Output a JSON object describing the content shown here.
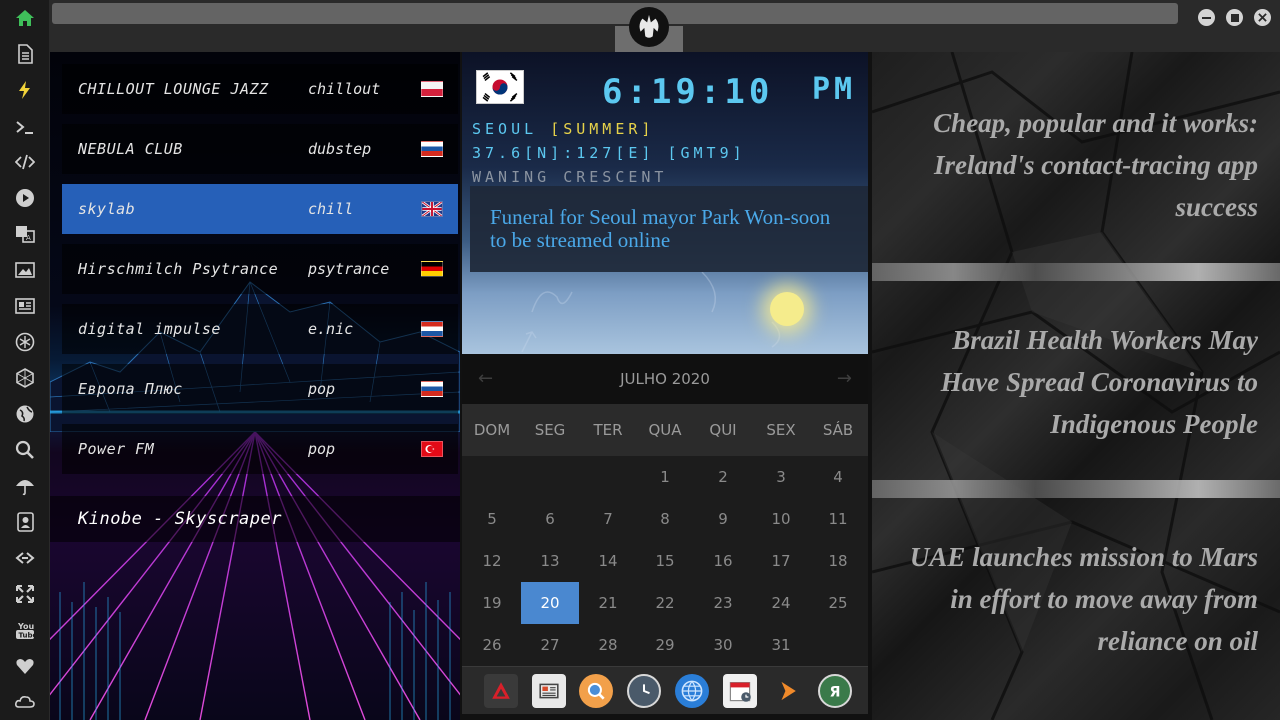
{
  "sidebar": {
    "items": [
      {
        "icon": "home-icon",
        "color": "#3fbf5a"
      },
      {
        "icon": "document-icon"
      },
      {
        "icon": "bolt-icon",
        "color": "#f2d43a"
      },
      {
        "icon": "terminal-icon"
      },
      {
        "icon": "code-icon"
      },
      {
        "icon": "play-icon"
      },
      {
        "icon": "translate-icon"
      },
      {
        "icon": "image-icon"
      },
      {
        "icon": "newspaper-icon"
      },
      {
        "icon": "rebel-icon"
      },
      {
        "icon": "hexagon-icon"
      },
      {
        "icon": "globe-icon"
      },
      {
        "icon": "search-icon"
      },
      {
        "icon": "umbrella-icon"
      },
      {
        "icon": "contact-icon"
      },
      {
        "icon": "link-icon"
      },
      {
        "icon": "expand-icon"
      },
      {
        "icon": "youtube-icon"
      },
      {
        "icon": "heart-icon"
      },
      {
        "icon": "cloud-icon"
      }
    ]
  },
  "radio": {
    "stations": [
      {
        "name": "CHILLOUT LOUNGE JAZZ",
        "genre": "chillout",
        "flag": "poland"
      },
      {
        "name": "NEBULA CLUB",
        "genre": "dubstep",
        "flag": "russia"
      },
      {
        "name": "skylab",
        "genre": "chill",
        "flag": "uk",
        "active": true
      },
      {
        "name": "Hirschmilch Psytrance",
        "genre": "psytrance",
        "flag": "germany"
      },
      {
        "name": "digital impulse",
        "genre": "e.nic",
        "flag": "croatia"
      },
      {
        "name": "Европа Плюс",
        "genre": "pop",
        "flag": "russia"
      },
      {
        "name": "Power FM",
        "genre": "pop",
        "flag": "turkey"
      }
    ],
    "now_playing": "Kinobe - Skyscraper"
  },
  "clock": {
    "time": "6:19:10",
    "ampm": "PM",
    "location": "SEOUL",
    "season": "[SUMMER]",
    "coords": "37.6[N]:127[E] [GMT9]",
    "moon_phase": "WANING CRESCENT",
    "headline": "Funeral for Seoul mayor Park Won-soon to be streamed online"
  },
  "calendar": {
    "month_label": "JULHO 2020",
    "prev": "←",
    "next": "→",
    "weekdays": [
      "DOM",
      "SEG",
      "TER",
      "QUA",
      "QUI",
      "SEX",
      "SÁB"
    ],
    "first_weekday_index": 3,
    "days_in_month": 31,
    "today": 20
  },
  "dock": {
    "items": [
      "adobe-reader-icon",
      "news-reader-icon",
      "magnifier-icon",
      "clock-icon",
      "browser-globe-icon",
      "calendar-app-icon",
      "forward-arrow-icon",
      "yandex-icon"
    ]
  },
  "news": {
    "headlines": [
      "Cheap, popular and it works: Ireland's contact-tracing app success",
      "Brazil Health Workers May Have Spread Coronavirus to Indigenous People",
      "UAE launches mission to Mars in effort to move away from reliance on oil"
    ]
  },
  "colors": {
    "accent_blue": "#2660b8",
    "today_highlight": "#4a88d0",
    "digital_cyan": "#5cc8f0",
    "digital_yellow": "#e6d24a",
    "headline_blue": "#4aa8e8"
  }
}
